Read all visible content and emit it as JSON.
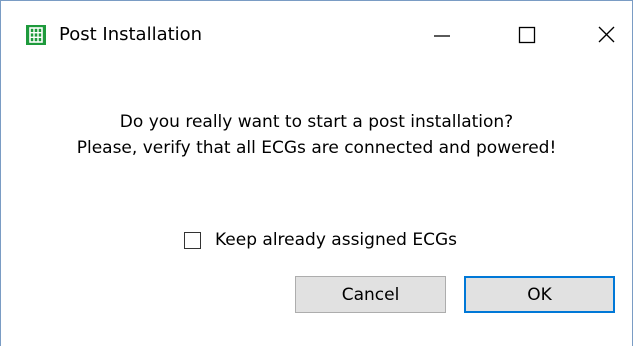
{
  "window": {
    "title": "Post Installation",
    "icon": "grid-app-icon",
    "accent_color": "#1e9a3c",
    "controls": {
      "minimize": "minimize-icon",
      "maximize": "maximize-icon",
      "close": "close-icon"
    }
  },
  "dialog": {
    "message_line1": "Do you really want to start a post installation?",
    "message_line2": "Please, verify that all ECGs are connected and powered!",
    "checkbox_label": "Keep already assigned ECGs",
    "checkbox_checked": false,
    "cancel_label": "Cancel",
    "ok_label": "OK",
    "default_button_color": "#0078d7"
  }
}
